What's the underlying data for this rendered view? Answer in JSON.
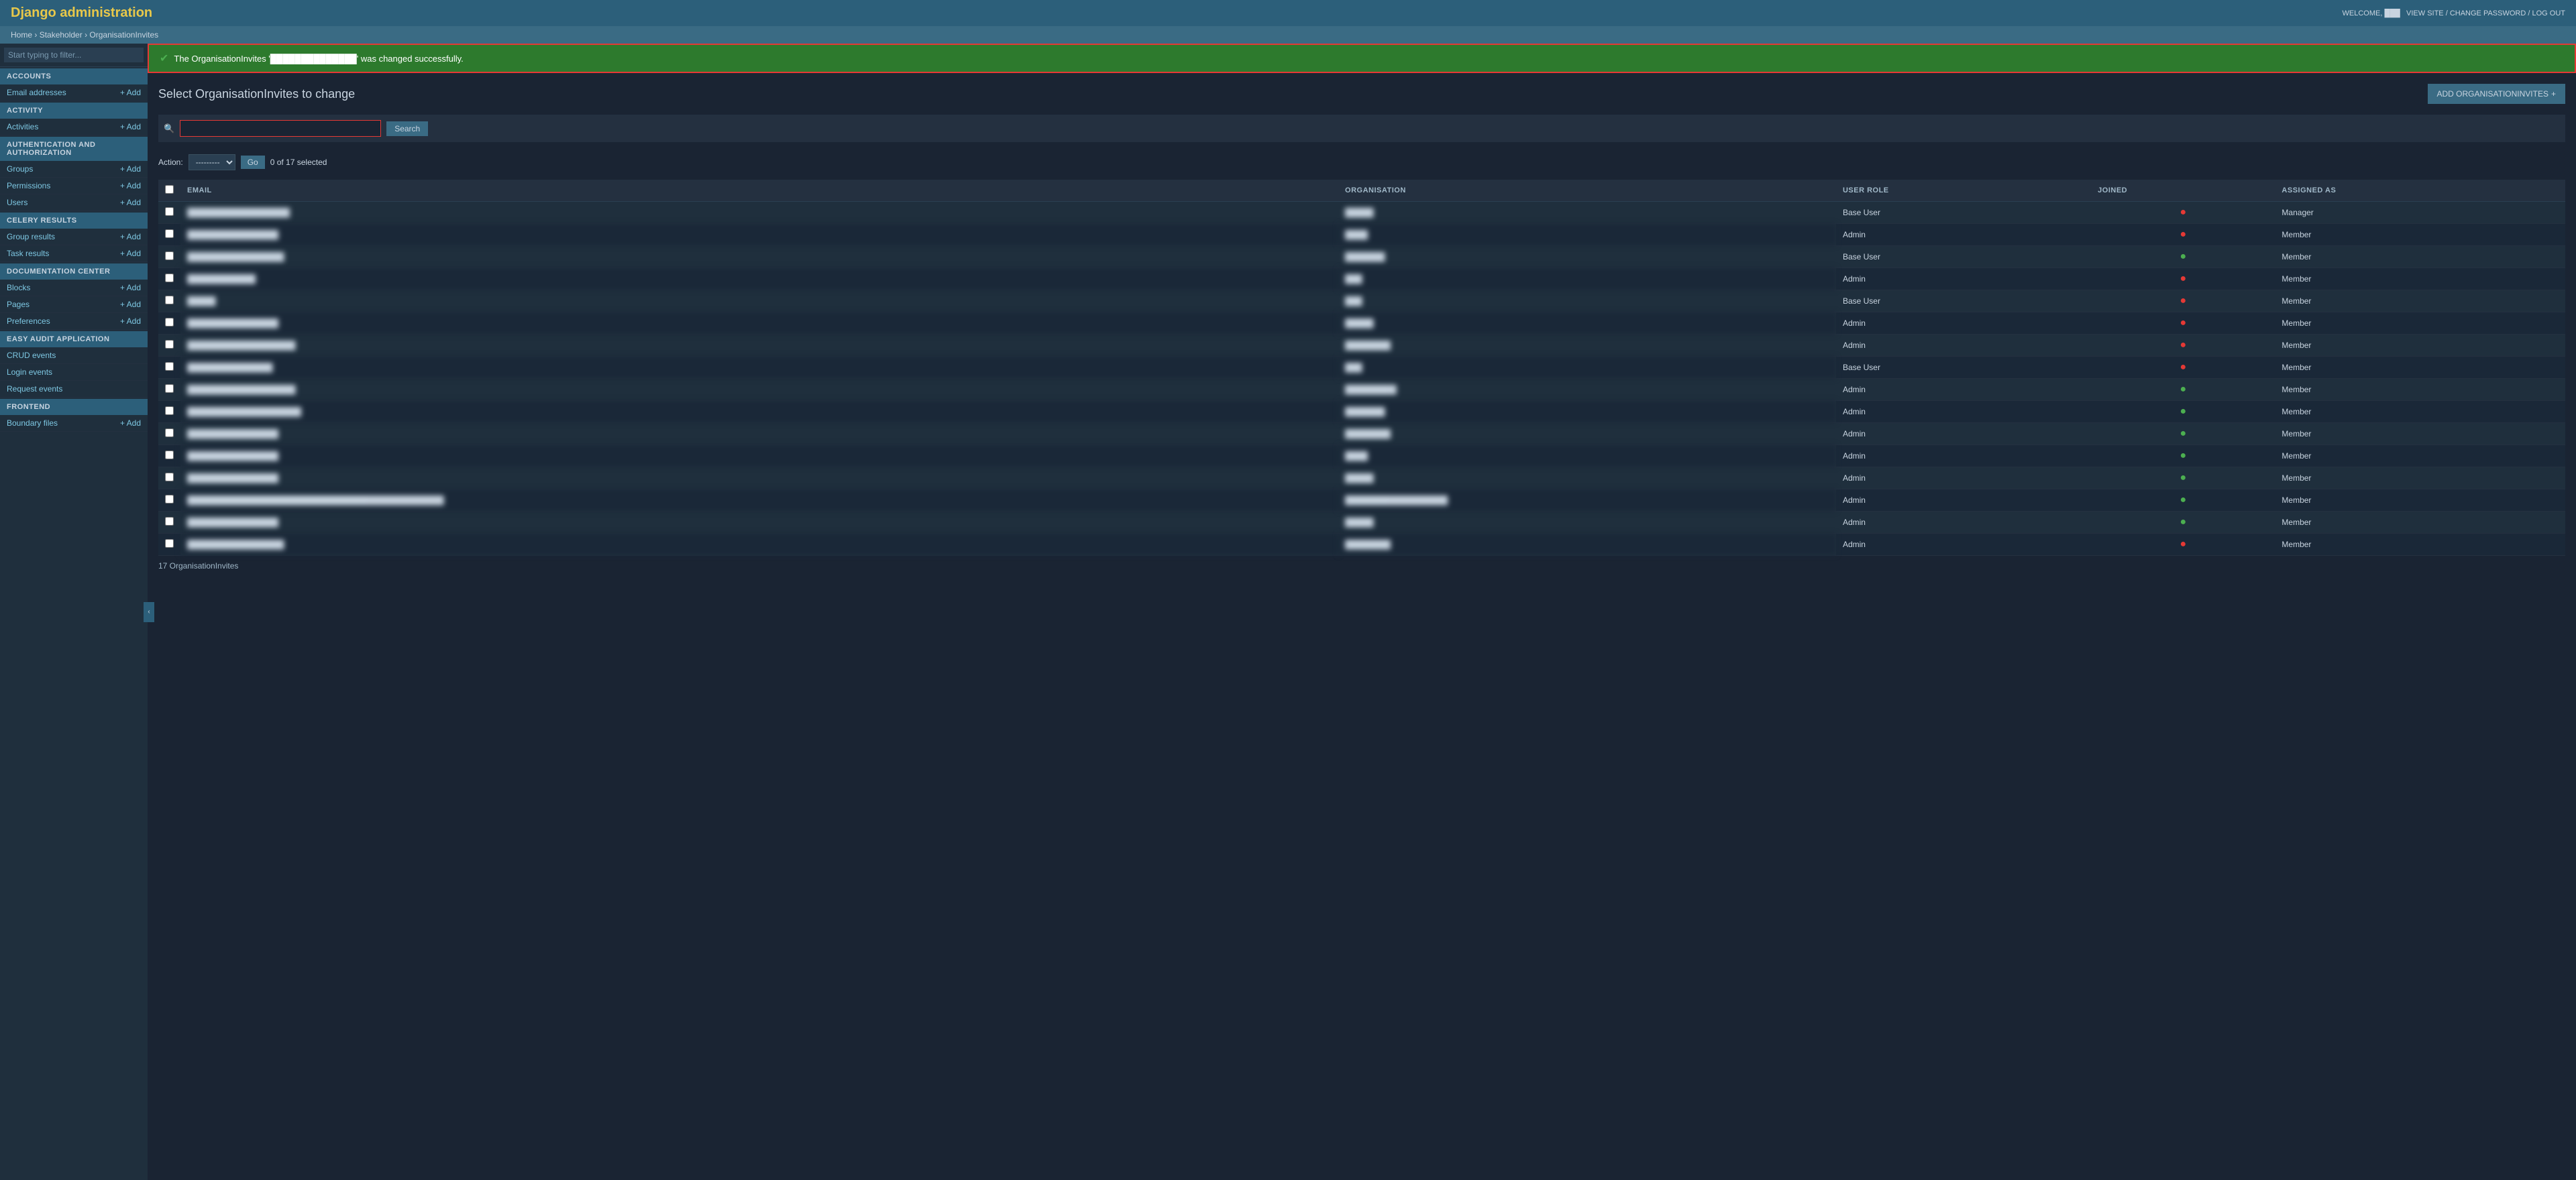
{
  "header": {
    "title": "Django administration",
    "welcome": "WELCOME,",
    "username": "███",
    "view_site": "VIEW SITE",
    "change_password": "CHANGE PASSWORD",
    "logout": "LOG OUT"
  },
  "breadcrumb": {
    "home": "Home",
    "stakeholder": "Stakeholder",
    "current": "OrganisationInvites"
  },
  "success_message": "The OrganisationInvites '██████████████' was changed successfully.",
  "page_title": "Select OrganisationInvites to change",
  "add_button": "ADD ORGANISATIONINVITES",
  "search": {
    "placeholder": "",
    "button_label": "Search"
  },
  "action": {
    "label": "Action:",
    "default_option": "---------",
    "go_button": "Go",
    "selected_text": "0 of 17 selected"
  },
  "table": {
    "columns": [
      "EMAIL",
      "ORGANISATION",
      "USER ROLE",
      "JOINED",
      "ASSIGNED AS"
    ],
    "rows": [
      {
        "email": "██████████████████",
        "org": "█████",
        "role": "Base User",
        "joined": "red",
        "assigned": "Manager"
      },
      {
        "email": "████████████████",
        "org": "████",
        "role": "Admin",
        "joined": "red",
        "assigned": "Member"
      },
      {
        "email": "█████████████████",
        "org": "███████",
        "role": "Base User",
        "joined": "green",
        "assigned": "Member"
      },
      {
        "email": "████████████",
        "org": "███",
        "role": "Admin",
        "joined": "red",
        "assigned": "Member"
      },
      {
        "email": "█████",
        "org": "███",
        "role": "Base User",
        "joined": "red",
        "assigned": "Member"
      },
      {
        "email": "████████████████",
        "org": "█████",
        "role": "Admin",
        "joined": "red",
        "assigned": "Member"
      },
      {
        "email": "███████████████████",
        "org": "████████",
        "role": "Admin",
        "joined": "red",
        "assigned": "Member"
      },
      {
        "email": "███████████████",
        "org": "███",
        "role": "Base User",
        "joined": "red",
        "assigned": "Member"
      },
      {
        "email": "███████████████████",
        "org": "█████████",
        "role": "Admin",
        "joined": "green",
        "assigned": "Member"
      },
      {
        "email": "████████████████████",
        "org": "███████",
        "role": "Admin",
        "joined": "green",
        "assigned": "Member"
      },
      {
        "email": "████████████████",
        "org": "████████",
        "role": "Admin",
        "joined": "green",
        "assigned": "Member"
      },
      {
        "email": "████████████████",
        "org": "████",
        "role": "Admin",
        "joined": "green",
        "assigned": "Member"
      },
      {
        "email": "████████████████",
        "org": "█████",
        "role": "Admin",
        "joined": "green",
        "assigned": "Member"
      },
      {
        "email": "█████████████████████████████████████████████",
        "org": "██████████████████",
        "role": "Admin",
        "joined": "green",
        "assigned": "Member"
      },
      {
        "email": "████████████████",
        "org": "█████",
        "role": "Admin",
        "joined": "green",
        "assigned": "Member"
      },
      {
        "email": "█████████████████",
        "org": "████████",
        "role": "Admin",
        "joined": "red",
        "assigned": "Member"
      }
    ]
  },
  "results_count": "17 OrganisationInvites",
  "sidebar": {
    "filter_placeholder": "Start typing to filter...",
    "sections": [
      {
        "header": "ACCOUNTS",
        "items": [
          {
            "label": "Email addresses",
            "add": true
          }
        ]
      },
      {
        "header": "ACTIVITY",
        "items": [
          {
            "label": "Activities",
            "add": true
          }
        ]
      },
      {
        "header": "AUTHENTICATION AND AUTHORIZATION",
        "items": [
          {
            "label": "Groups",
            "add": true
          },
          {
            "label": "Permissions",
            "add": true
          },
          {
            "label": "Users",
            "add": true
          }
        ]
      },
      {
        "header": "CELERY RESULTS",
        "items": [
          {
            "label": "Group results",
            "add": true
          },
          {
            "label": "Task results",
            "add": true
          }
        ]
      },
      {
        "header": "DOCUMENTATION CENTER",
        "items": [
          {
            "label": "Blocks",
            "add": true
          },
          {
            "label": "Pages",
            "add": true
          },
          {
            "label": "Preferences",
            "add": true
          }
        ]
      },
      {
        "header": "EASY AUDIT APPLICATION",
        "items": [
          {
            "label": "CRUD events",
            "add": false
          },
          {
            "label": "Login events",
            "add": false
          },
          {
            "label": "Request events",
            "add": false
          }
        ]
      },
      {
        "header": "FRONTEND",
        "items": [
          {
            "label": "Boundary files",
            "add": true
          }
        ]
      }
    ]
  }
}
